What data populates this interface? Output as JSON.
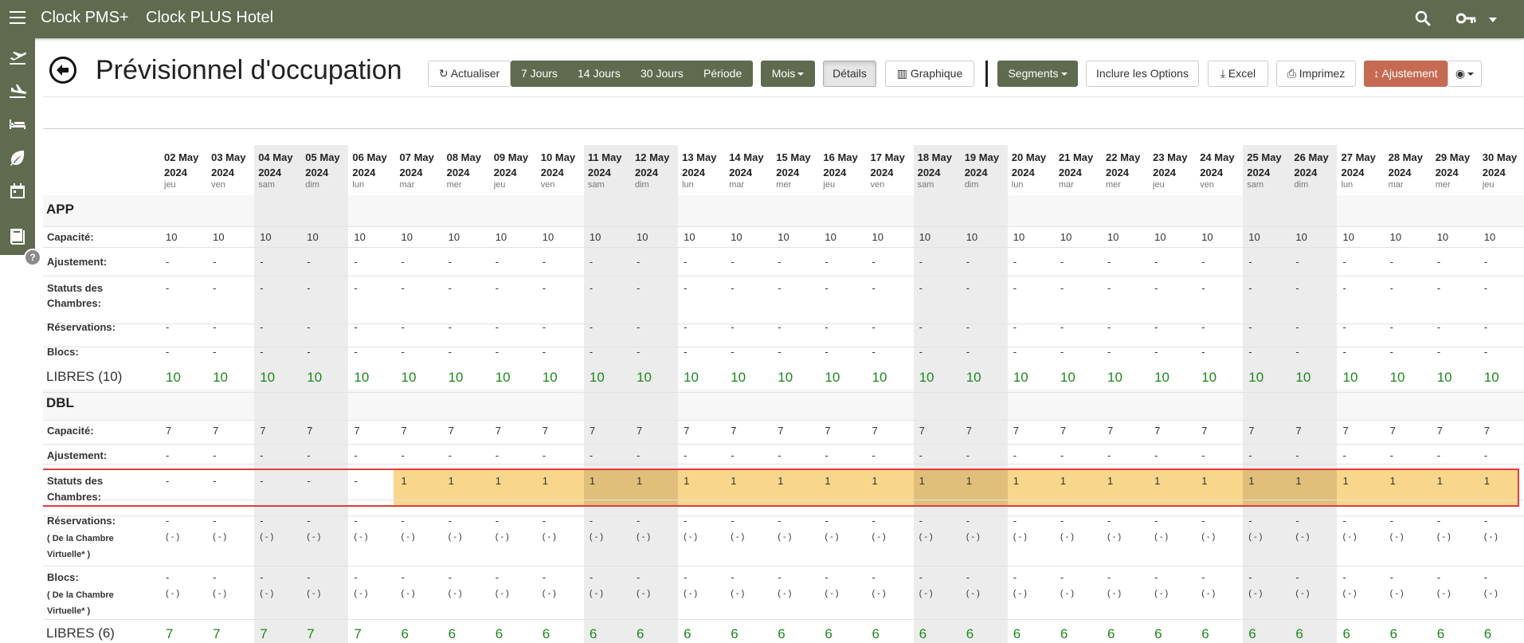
{
  "app": {
    "brand": "Clock PMS+",
    "hotel": "Clock PLUS Hotel"
  },
  "topbar_icons": [
    "menu-icon",
    "search-icon",
    "key-icon",
    "dropdown-caret-icon"
  ],
  "sidebar_icons": [
    "departures-icon",
    "arrivals-icon",
    "bed-icon",
    "leaf-icon",
    "calendar-icon",
    "book-icon"
  ],
  "help": "?",
  "page": {
    "title": "Prévisionnel d'occupation"
  },
  "toolbar": {
    "refresh": "Actualiser",
    "periods": [
      "7 Jours",
      "14 Jours",
      "30 Jours",
      "Période"
    ],
    "month": "Mois",
    "details": "Détails",
    "chart": "Graphique",
    "segments": "Segments",
    "include_options": "Inclure les Options",
    "excel": "Excel",
    "print": "Imprimez",
    "adjust": "Ajustement",
    "view_icon": "eye-icon"
  },
  "colors": {
    "topbar": "#5f6a4f",
    "highlight": "#f8d68c",
    "highlight_border": "#e03b3b",
    "free": "#1a8a1a",
    "weekend": "#ececec"
  },
  "dates": [
    {
      "d": "02 May",
      "y": "2024",
      "wd": "jeu",
      "weekend": false
    },
    {
      "d": "03 May",
      "y": "2024",
      "wd": "ven",
      "weekend": false
    },
    {
      "d": "04 May",
      "y": "2024",
      "wd": "sam",
      "weekend": true
    },
    {
      "d": "05 May",
      "y": "2024",
      "wd": "dim",
      "weekend": true
    },
    {
      "d": "06 May",
      "y": "2024",
      "wd": "lun",
      "weekend": false
    },
    {
      "d": "07 May",
      "y": "2024",
      "wd": "mar",
      "weekend": false
    },
    {
      "d": "08 May",
      "y": "2024",
      "wd": "mer",
      "weekend": false
    },
    {
      "d": "09 May",
      "y": "2024",
      "wd": "jeu",
      "weekend": false
    },
    {
      "d": "10 May",
      "y": "2024",
      "wd": "ven",
      "weekend": false
    },
    {
      "d": "11 May",
      "y": "2024",
      "wd": "sam",
      "weekend": true
    },
    {
      "d": "12 May",
      "y": "2024",
      "wd": "dim",
      "weekend": true
    },
    {
      "d": "13 May",
      "y": "2024",
      "wd": "lun",
      "weekend": false
    },
    {
      "d": "14 May",
      "y": "2024",
      "wd": "mar",
      "weekend": false
    },
    {
      "d": "15 May",
      "y": "2024",
      "wd": "mer",
      "weekend": false
    },
    {
      "d": "16 May",
      "y": "2024",
      "wd": "jeu",
      "weekend": false
    },
    {
      "d": "17 May",
      "y": "2024",
      "wd": "ven",
      "weekend": false
    },
    {
      "d": "18 May",
      "y": "2024",
      "wd": "sam",
      "weekend": true
    },
    {
      "d": "19 May",
      "y": "2024",
      "wd": "dim",
      "weekend": true
    },
    {
      "d": "20 May",
      "y": "2024",
      "wd": "lun",
      "weekend": false
    },
    {
      "d": "21 May",
      "y": "2024",
      "wd": "mar",
      "weekend": false
    },
    {
      "d": "22 May",
      "y": "2024",
      "wd": "mer",
      "weekend": false
    },
    {
      "d": "23 May",
      "y": "2024",
      "wd": "jeu",
      "weekend": false
    },
    {
      "d": "24 May",
      "y": "2024",
      "wd": "ven",
      "weekend": false
    },
    {
      "d": "25 May",
      "y": "2024",
      "wd": "sam",
      "weekend": true
    },
    {
      "d": "26 May",
      "y": "2024",
      "wd": "dim",
      "weekend": true
    },
    {
      "d": "27 May",
      "y": "2024",
      "wd": "lun",
      "weekend": false
    },
    {
      "d": "28 May",
      "y": "2024",
      "wd": "mar",
      "weekend": false
    },
    {
      "d": "29 May",
      "y": "2024",
      "wd": "mer",
      "weekend": false
    },
    {
      "d": "30 May",
      "y": "2024",
      "wd": "jeu",
      "weekend": false
    }
  ],
  "labels": {
    "capacity": "Capacité:",
    "adjust": "Ajustement:",
    "status_1": "Statuts des",
    "status_2": "Chambres:",
    "reservations": "Réservations:",
    "blocks": "Blocs:",
    "virtual_1": "( De la Chambre",
    "virtual_2": "Virtuelle* )",
    "dash": "-",
    "paren_dash": "( - )"
  },
  "sections": [
    {
      "name": "APP",
      "libres": "LIBRES (10)",
      "capacity": "10",
      "status": [
        "-",
        "-",
        "-",
        "-",
        "-",
        "-",
        "-",
        "-",
        "-",
        "-",
        "-",
        "-",
        "-",
        "-",
        "-",
        "-",
        "-",
        "-",
        "-",
        "-",
        "-",
        "-",
        "-",
        "-",
        "-",
        "-",
        "-",
        "-",
        "-"
      ],
      "free": [
        "10",
        "10",
        "10",
        "10",
        "10",
        "10",
        "10",
        "10",
        "10",
        "10",
        "10",
        "10",
        "10",
        "10",
        "10",
        "10",
        "10",
        "10",
        "10",
        "10",
        "10",
        "10",
        "10",
        "10",
        "10",
        "10",
        "10",
        "10",
        "10"
      ]
    },
    {
      "name": "DBL",
      "libres": "LIBRES (6)",
      "capacity": "7",
      "status": [
        "-",
        "-",
        "-",
        "-",
        "-",
        "1",
        "1",
        "1",
        "1",
        "1",
        "1",
        "1",
        "1",
        "1",
        "1",
        "1",
        "1",
        "1",
        "1",
        "1",
        "1",
        "1",
        "1",
        "1",
        "1",
        "1",
        "1",
        "1",
        "1"
      ],
      "free": [
        "7",
        "7",
        "7",
        "7",
        "7",
        "6",
        "6",
        "6",
        "6",
        "6",
        "6",
        "6",
        "6",
        "6",
        "6",
        "6",
        "6",
        "6",
        "6",
        "6",
        "6",
        "6",
        "6",
        "6",
        "6",
        "6",
        "6",
        "6",
        "6"
      ]
    }
  ]
}
